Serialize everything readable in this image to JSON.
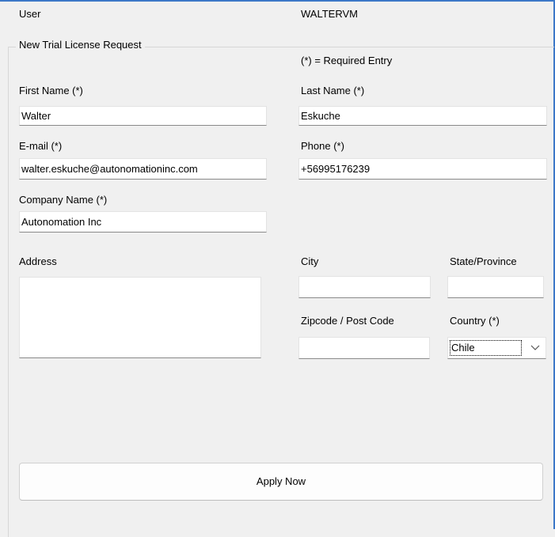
{
  "header": {
    "user_label": "User",
    "user_value": "WALTERVM"
  },
  "group": {
    "title": "New Trial License Request",
    "required_note": "(*) = Required Entry"
  },
  "fields": {
    "first_name": {
      "label": "First Name (*)",
      "value": "Walter"
    },
    "last_name": {
      "label": "Last Name (*)",
      "value": "Eskuche"
    },
    "email": {
      "label": "E-mail (*)",
      "value": "walter.eskuche@autonomationinc.com"
    },
    "phone": {
      "label": "Phone (*)",
      "value": "+56995176239"
    },
    "company": {
      "label": "Company Name (*)",
      "value": "Autonomation Inc"
    },
    "address": {
      "label": "Address",
      "value": ""
    },
    "city": {
      "label": "City",
      "value": ""
    },
    "state": {
      "label": "State/Province",
      "value": ""
    },
    "zip": {
      "label": "Zipcode / Post Code",
      "value": ""
    },
    "country": {
      "label": "Country (*)",
      "value": "Chile"
    }
  },
  "actions": {
    "apply_label": "Apply Now"
  },
  "colors": {
    "window_bg": "#f0f0f0",
    "accent_border": "#3c78c8",
    "field_bg": "#ffffff"
  },
  "icons": {
    "country_dropdown": "chevron-down-icon"
  }
}
